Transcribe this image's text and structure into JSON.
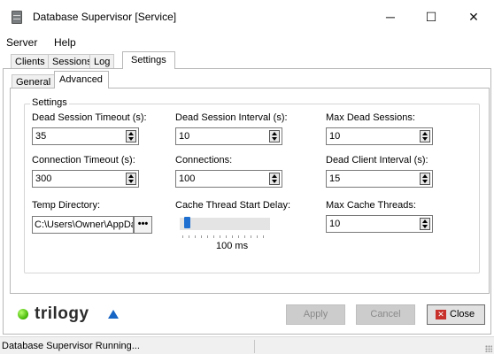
{
  "window": {
    "title": "Database Supervisor [Service]",
    "minimize_glyph": "─",
    "maximize_glyph": "☐",
    "close_glyph": "✕"
  },
  "menu": [
    "Server",
    "Help"
  ],
  "main_tabs": [
    "Clients",
    "Sessions",
    "Log",
    "Settings"
  ],
  "active_main_tab": "Settings",
  "sub_tabs": [
    "General",
    "Advanced"
  ],
  "active_sub_tab": "Advanced",
  "settings": {
    "group_label": "Settings",
    "dead_session_timeout": {
      "label": "Dead Session Timeout (s):",
      "value": "35"
    },
    "dead_session_interval": {
      "label": "Dead Session Interval (s):",
      "value": "10"
    },
    "max_dead_sessions": {
      "label": "Max Dead Sessions:",
      "value": "10"
    },
    "connection_timeout": {
      "label": "Connection Timeout (s):",
      "value": "300"
    },
    "connections": {
      "label": "Connections:",
      "value": "100"
    },
    "dead_client_interval": {
      "label": "Dead Client Interval (s):",
      "value": "15"
    },
    "temp_directory": {
      "label": "Temp Directory:",
      "value": "C:\\Users\\Owner\\AppDat",
      "browse_label": "•••"
    },
    "cache_thread_start_delay": {
      "label": "Cache Thread Start Delay:",
      "value_text": "100 ms",
      "level": 0.05
    },
    "max_cache_threads": {
      "label": "Max Cache Threads:",
      "value": "10"
    }
  },
  "logo": {
    "text": "trilogy",
    "accent_color": "#1665c4",
    "dot_color": "#5fd400"
  },
  "buttons": {
    "apply": "Apply",
    "cancel": "Cancel",
    "close": "Close"
  },
  "status": {
    "text": "Database Supervisor Running..."
  }
}
